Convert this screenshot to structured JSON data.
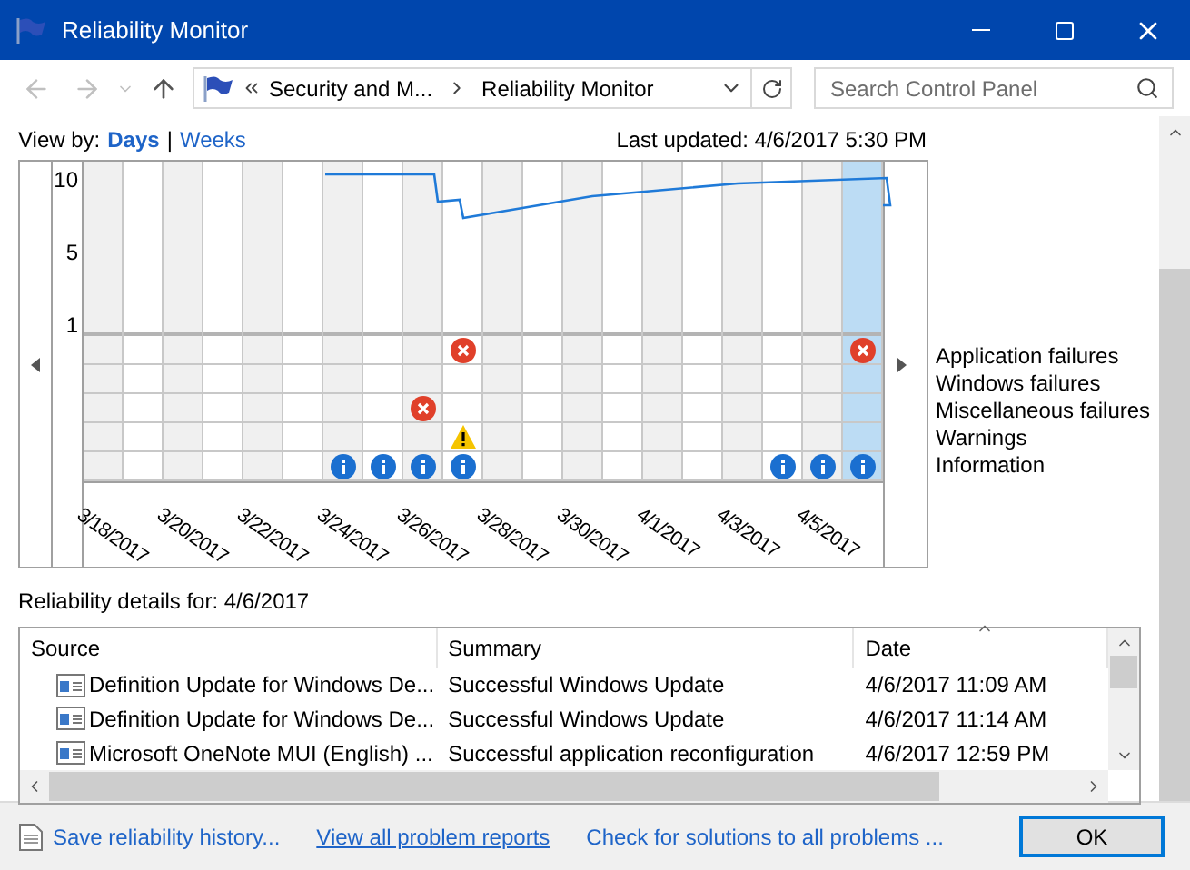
{
  "window": {
    "title": "Reliability Monitor"
  },
  "breadcrumb": [
    "Security and M...",
    "Reliability Monitor"
  ],
  "search": {
    "placeholder": "Search Control Panel"
  },
  "view_by": {
    "label": "View by:",
    "separator": "|",
    "options": [
      {
        "label": "Days",
        "selected": true
      },
      {
        "label": "Weeks",
        "selected": false
      }
    ]
  },
  "last_updated": "Last updated: 4/6/2017 5:30 PM",
  "chart": {
    "y_labels": [
      "10",
      "5",
      "1"
    ],
    "event_rows": [
      {
        "label": "Application failures",
        "kind": "app_failure"
      },
      {
        "label": "Windows failures",
        "kind": "windows_failure"
      },
      {
        "label": "Miscellaneous failures",
        "kind": "misc_failure"
      },
      {
        "label": "Warnings",
        "kind": "warning"
      },
      {
        "label": "Information",
        "kind": "information"
      }
    ],
    "days": [
      {
        "date": "3/18/2017",
        "selected": false
      },
      {
        "selected": false
      },
      {
        "date": "3/20/2017",
        "selected": false
      },
      {
        "selected": false
      },
      {
        "date": "3/22/2017",
        "selected": false
      },
      {
        "selected": false
      },
      {
        "date": "3/24/2017",
        "selected": false,
        "events": [
          {
            "kind": "information"
          }
        ]
      },
      {
        "selected": false,
        "events": [
          {
            "kind": "information"
          }
        ]
      },
      {
        "date": "3/26/2017",
        "selected": false,
        "events": [
          {
            "kind": "misc_failure"
          },
          {
            "kind": "information"
          }
        ]
      },
      {
        "selected": false,
        "events": [
          {
            "kind": "app_failure"
          },
          {
            "kind": "warning"
          },
          {
            "kind": "information"
          }
        ]
      },
      {
        "date": "3/28/2017",
        "selected": false
      },
      {
        "selected": false
      },
      {
        "date": "3/30/2017",
        "selected": false
      },
      {
        "selected": false
      },
      {
        "date": "4/1/2017",
        "selected": false
      },
      {
        "selected": false
      },
      {
        "date": "4/3/2017",
        "selected": false
      },
      {
        "selected": false,
        "events": [
          {
            "kind": "information"
          }
        ]
      },
      {
        "date": "4/5/2017",
        "selected": false,
        "events": [
          {
            "kind": "information"
          }
        ]
      },
      {
        "selected": true,
        "events": [
          {
            "kind": "app_failure"
          },
          {
            "kind": "information"
          }
        ]
      }
    ]
  },
  "details_label": "Reliability details for: 4/6/2017",
  "table": {
    "columns": [
      {
        "label": "Source",
        "sorted": false
      },
      {
        "label": "Summary",
        "sorted": false
      },
      {
        "label": "Date",
        "sorted": true
      }
    ],
    "rows": [
      [
        "Definition Update for Windows De...",
        "Successful Windows Update",
        "4/6/2017 11:09 AM"
      ],
      [
        "Definition Update for Windows De...",
        "Successful Windows Update",
        "4/6/2017 11:14 AM"
      ],
      [
        "Microsoft OneNote MUI (English) ...",
        "Successful application reconfiguration",
        "4/6/2017 12:59 PM"
      ]
    ]
  },
  "footer": {
    "links": [
      "Save reliability history...",
      "View all problem reports",
      "Check for solutions to all problems ..."
    ],
    "button": "OK"
  }
}
